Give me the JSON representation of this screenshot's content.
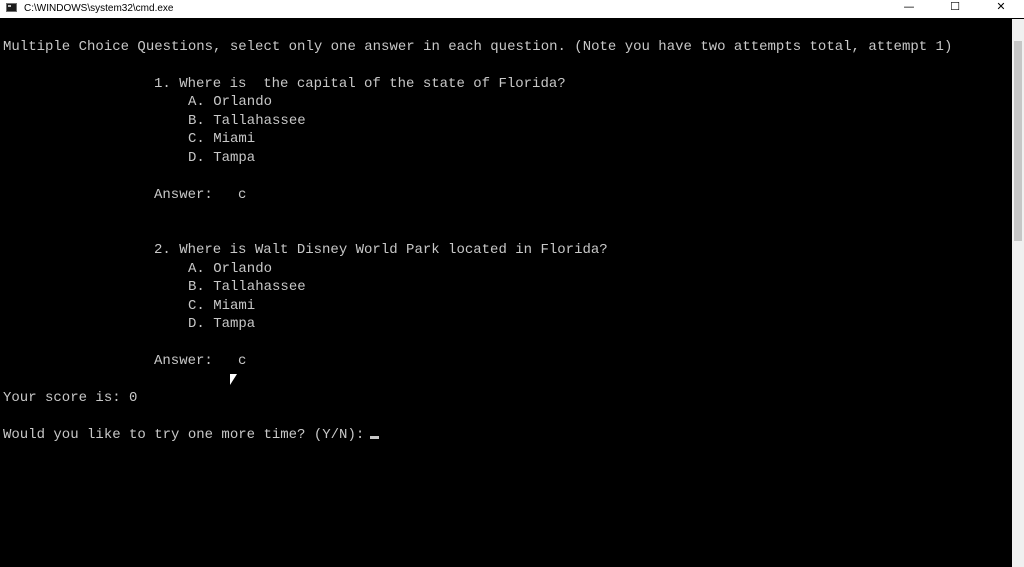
{
  "window": {
    "title": "C:\\WINDOWS\\system32\\cmd.exe",
    "icon": "console-icon",
    "buttons": {
      "minimize": "—",
      "maximize": "☐",
      "close": "✕"
    }
  },
  "console": {
    "header": "Multiple Choice Questions, select only one answer in each question. (Note you have two attempts total, attempt 1)",
    "questions": [
      {
        "prompt": "1. Where is  the capital of the state of Florida?",
        "options": [
          "A. Orlando",
          "B. Tallahassee",
          "C. Miami",
          "D. Tampa"
        ],
        "answer_line": "Answer:   c"
      },
      {
        "prompt": "2. Where is Walt Disney World Park located in Florida?",
        "options": [
          "A. Orlando",
          "B. Tallahassee",
          "C. Miami",
          "D. Tampa"
        ],
        "answer_line": "Answer:   c"
      }
    ],
    "score_line": "Your score is: 0",
    "retry_prompt": "Would you like to try one more time? (Y/N):"
  },
  "colors": {
    "console_bg": "#000000",
    "console_text": "#c8c8c8",
    "titlebar_bg": "#ffffff"
  }
}
